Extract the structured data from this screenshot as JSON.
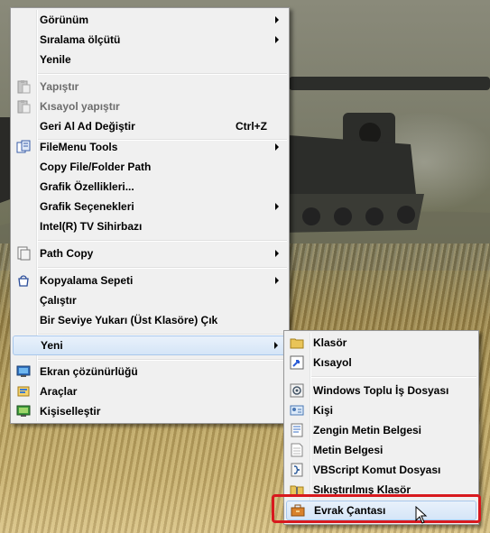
{
  "main_menu": {
    "items": [
      {
        "label": "Görünüm",
        "submenu": true
      },
      {
        "label": "Sıralama ölçütü",
        "submenu": true
      },
      {
        "label": "Yenile"
      },
      {
        "label": "Yapıştır",
        "disabled": true,
        "icon": "paste-icon"
      },
      {
        "label": "Kısayol yapıştır",
        "disabled": true,
        "icon": "paste-shortcut-icon"
      },
      {
        "label": "Geri Al Ad Değiştir",
        "shortcut": "Ctrl+Z"
      },
      {
        "label": "FileMenu Tools",
        "submenu": true,
        "icon": "filemenu-tools-icon"
      },
      {
        "label": "Copy File/Folder Path"
      },
      {
        "label": "Grafik Özellikleri..."
      },
      {
        "label": "Grafik Seçenekleri",
        "submenu": true
      },
      {
        "label": "Intel(R) TV Sihirbazı"
      },
      {
        "label": "Path Copy",
        "submenu": true,
        "icon": "path-copy-icon"
      },
      {
        "label": "Kopyalama Sepeti",
        "submenu": true,
        "icon": "basket-icon"
      },
      {
        "label": "Çalıştır"
      },
      {
        "label": "Bir Seviye Yukarı (Üst Klasöre) Çık"
      },
      {
        "label": "Yeni",
        "submenu": true,
        "highlighted": true
      },
      {
        "label": "Ekran çözünürlüğü",
        "icon": "display-icon"
      },
      {
        "label": "Araçlar",
        "icon": "tools-icon"
      },
      {
        "label": "Kişiselleştir",
        "icon": "personalize-icon"
      }
    ]
  },
  "new_submenu": {
    "items": [
      {
        "label": "Klasör",
        "icon": "folder-icon"
      },
      {
        "label": "Kısayol",
        "icon": "shortcut-icon"
      },
      {
        "label": "Windows Toplu İş Dosyası",
        "icon": "batch-file-icon"
      },
      {
        "label": "Kişi",
        "icon": "contact-icon"
      },
      {
        "label": "Zengin Metin Belgesi",
        "icon": "rich-text-icon"
      },
      {
        "label": "Metin Belgesi",
        "icon": "text-document-icon"
      },
      {
        "label": "VBScript Komut Dosyası",
        "icon": "vbscript-icon"
      },
      {
        "label": "Sıkıştırılmış Klasör",
        "icon": "zip-folder-icon"
      },
      {
        "label": "Evrak Çantası",
        "icon": "briefcase-icon",
        "highlighted": true
      }
    ]
  },
  "colors": {
    "menu_bg": "#f0f0f0",
    "highlight_border": "#a8c7ec",
    "annotation_red": "#d8191e",
    "disabled_text": "#6d6d6d"
  }
}
